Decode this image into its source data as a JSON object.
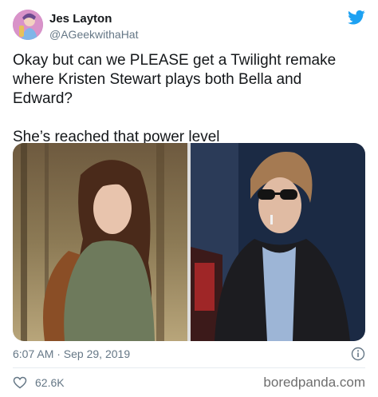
{
  "author": {
    "name": "Jes Layton",
    "handle": "@AGeekwithaHat"
  },
  "tweet": {
    "text_paragraph_1": "Okay but can we PLEASE get a Twilight remake where Kristen Stewart plays both Bella and Edward?",
    "text_paragraph_2": "She’s reached that power level"
  },
  "meta": {
    "timestamp": "6:07 AM · Sep 29, 2019"
  },
  "actions": {
    "like_count": "62.6K"
  },
  "watermark": "boredpanda.com",
  "icons": {
    "brand": "twitter-bird-icon",
    "info": "info-icon",
    "like": "heart-icon"
  },
  "colors": {
    "brand_blue": "#1da1f2",
    "text": "#14171a",
    "secondary_text": "#657786"
  }
}
